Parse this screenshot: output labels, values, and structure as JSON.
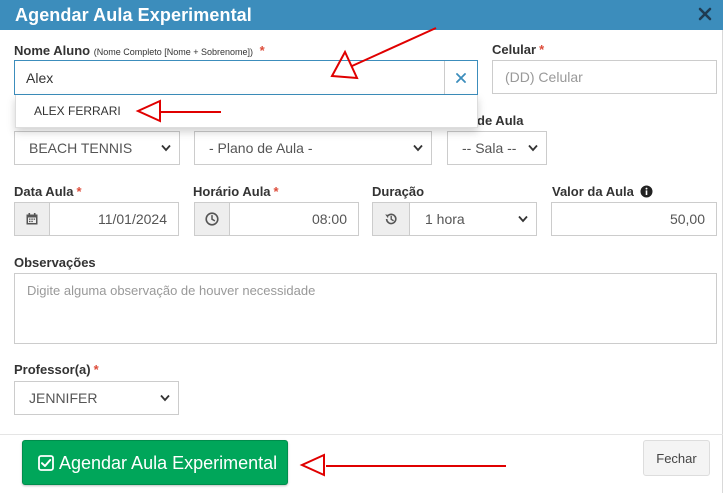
{
  "modal": {
    "title": "Agendar Aula Experimental",
    "close_icon": "close-icon"
  },
  "form": {
    "nome_aluno": {
      "label": "Nome Aluno",
      "hint": "(Nome Completo [Nome + Sobrenome])",
      "required": "*",
      "value": "Alex",
      "suggestions": [
        "ALEX FERRARI"
      ]
    },
    "celular": {
      "label": "Celular",
      "required": "*",
      "placeholder": "(DD) Celular"
    },
    "modalidade": {
      "selected": "BEACH TENNIS"
    },
    "plano_aula": {
      "selected": "- Plano de Aula -"
    },
    "sala": {
      "label_visible": "de Aula",
      "selected": "-- Sala --"
    },
    "data_aula": {
      "label": "Data Aula",
      "required": "*",
      "value": "11/01/2024",
      "icon": "calendar-icon"
    },
    "horario_aula": {
      "label": "Horário Aula",
      "required": "*",
      "value": "08:00",
      "icon": "clock-icon"
    },
    "duracao": {
      "label": "Duração",
      "selected": "1 hora",
      "icon": "history-icon"
    },
    "valor_aula": {
      "label": "Valor da Aula",
      "value": "50,00",
      "icon": "info-icon"
    },
    "observacoes": {
      "label": "Observações",
      "placeholder": "Digite alguma observação de houver necessidade"
    },
    "professor": {
      "label": "Professor(a)",
      "required": "*",
      "selected": "JENNIFER"
    }
  },
  "footer": {
    "submit_label": "Agendar Aula Experimental",
    "close_label": "Fechar"
  },
  "colors": {
    "header": "#3c8dbc",
    "submit": "#00a65a",
    "required": "#dd4b39",
    "annotation_arrows": "#e00000"
  }
}
